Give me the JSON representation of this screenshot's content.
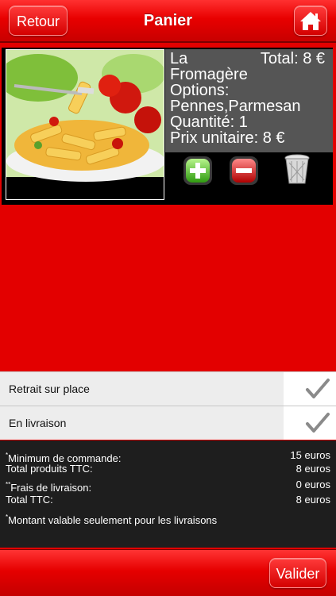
{
  "header": {
    "back_label": "Retour",
    "title": "Panier",
    "home_icon": "home-icon"
  },
  "cart_item": {
    "name": "La Fromagère",
    "total": "Total: 8 €",
    "options": "Options: Pennes,Parmesan",
    "quantity": "Quantité: 1",
    "unit_price": "Prix unitaire: 8 €",
    "actions": [
      "plus-icon",
      "minus-icon",
      "trash-icon"
    ]
  },
  "delivery_options": [
    {
      "label": "Retrait sur place",
      "icon": "checkmark-icon"
    },
    {
      "label": "En livraison",
      "icon": "checkmark-icon"
    }
  ],
  "summary": {
    "minimum_label": "Minimum de commande:",
    "minimum_value": "15 euros",
    "products_label": "Total produits TTC:",
    "products_value": "8 euros",
    "delivery_fee_label": "Frais de livraison:",
    "delivery_fee_value": "0 euros",
    "total_label": "Total TTC:",
    "total_value": "8 euros",
    "note": "Montant valable seulement pour les livraisons",
    "marker_single": "*",
    "marker_double": "**"
  },
  "footer": {
    "submit_label": "Valider"
  },
  "colors": {
    "brand_red": "#e30000",
    "dark_panel": "#1e1e1e",
    "info_gray": "#555555"
  }
}
